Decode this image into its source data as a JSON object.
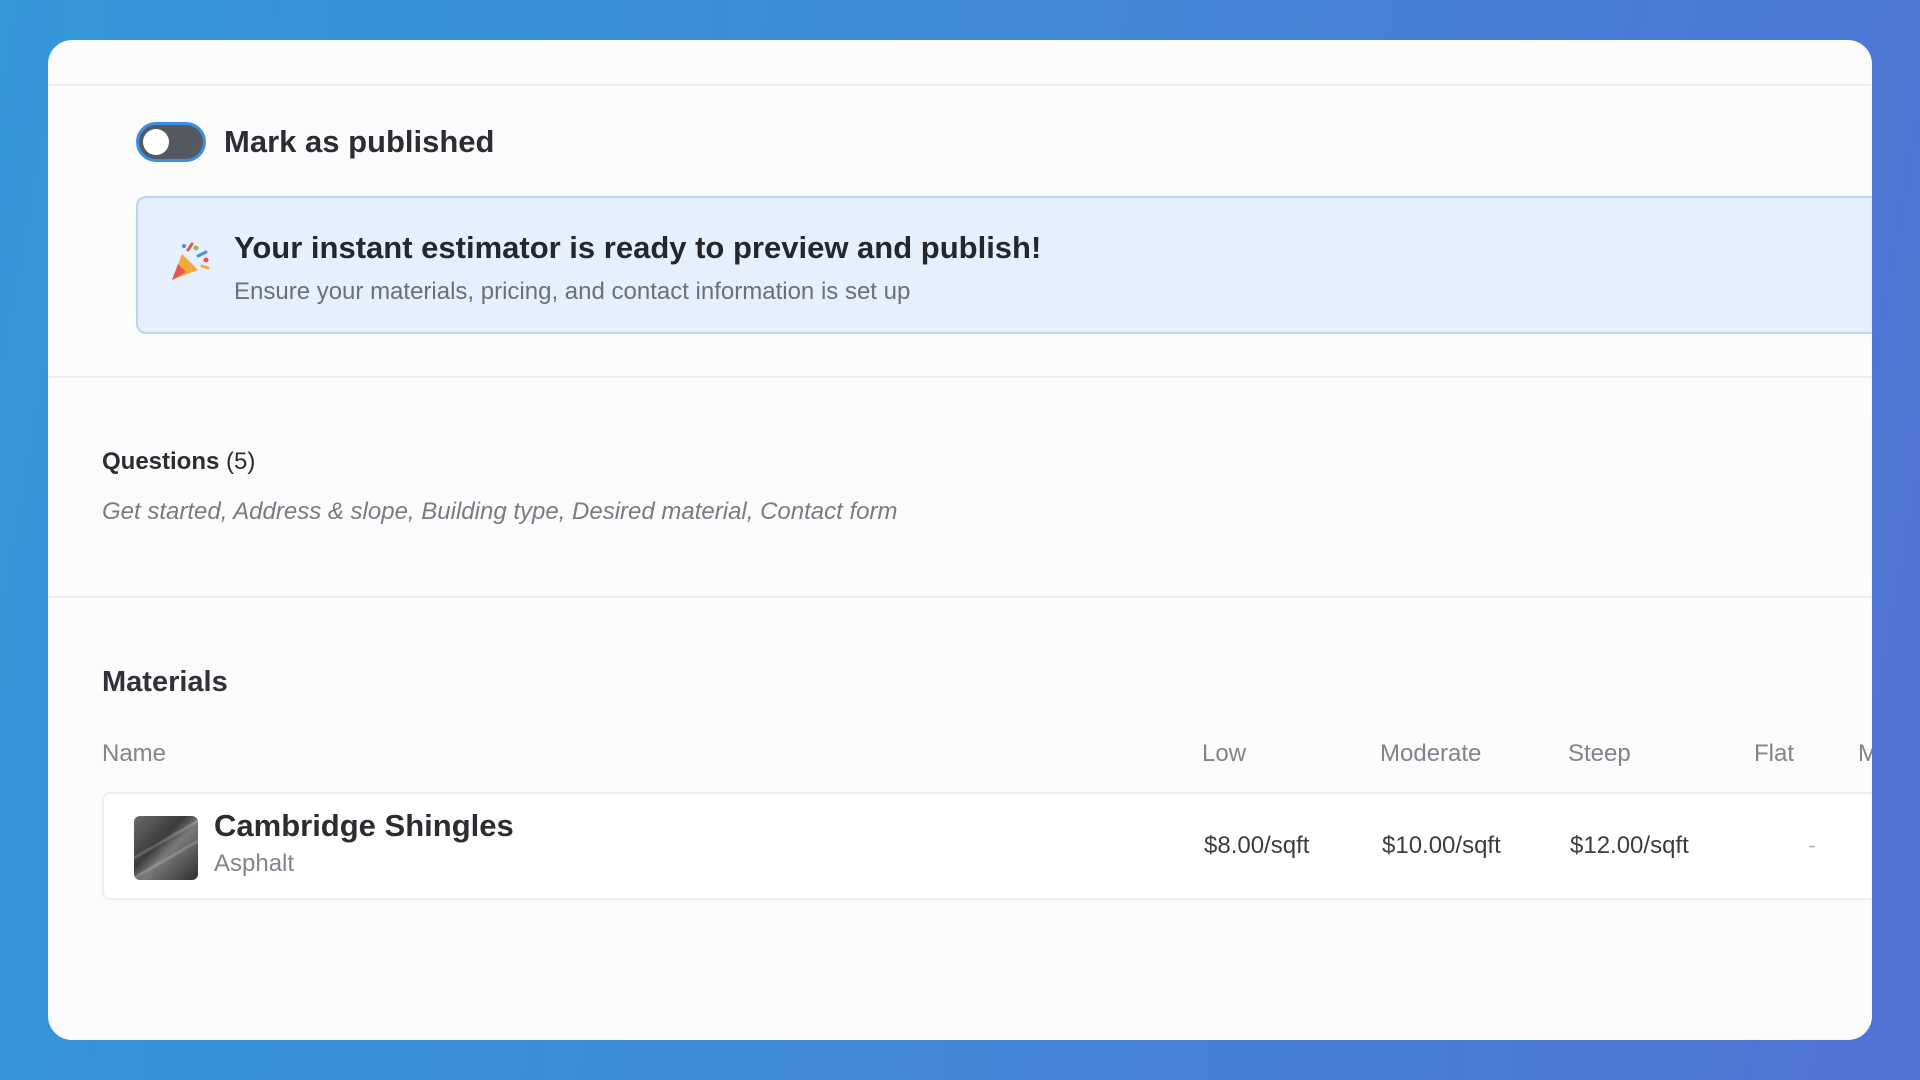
{
  "publish": {
    "toggle_label": "Mark as published",
    "state": "off"
  },
  "banner": {
    "icon": "party-popper-icon",
    "title": "Your instant estimator is ready to preview and publish!",
    "subtitle": "Ensure your materials, pricing, and contact information is set up"
  },
  "questions": {
    "heading": "Questions",
    "count": "(5)",
    "list": "Get started, Address & slope, Building type, Desired material, Contact form"
  },
  "materials": {
    "heading": "Materials",
    "columns": {
      "name": "Name",
      "low": "Low",
      "moderate": "Moderate",
      "steep": "Steep",
      "flat": "Flat",
      "partial": "M"
    },
    "rows": [
      {
        "name": "Cambridge Shingles",
        "type": "Asphalt",
        "thumbnail": "shingles-thumbnail",
        "low": "$8.00/sqft",
        "moderate": "$10.00/sqft",
        "steep": "$12.00/sqft",
        "flat": "-",
        "partial": "$"
      }
    ]
  },
  "colors": {
    "toggle_track": "#555a62",
    "toggle_ring": "#3d8fe4",
    "banner_bg": "#e6f0fc",
    "banner_border": "#b9d4f4",
    "page_bg_start": "#3497d8",
    "page_bg_end": "#5273d6"
  }
}
